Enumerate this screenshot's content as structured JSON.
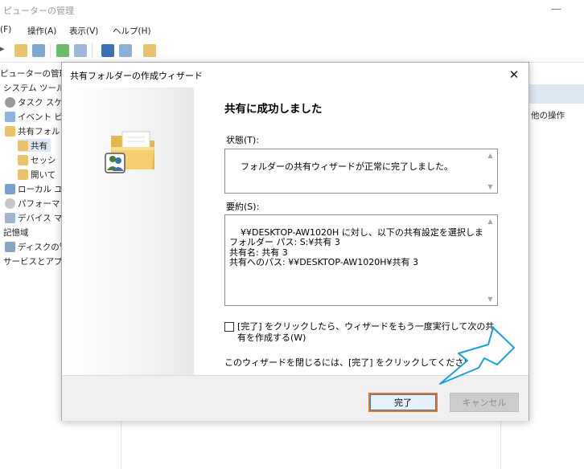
{
  "background": {
    "window_title": "ピューターの管理",
    "menus": [
      "(F)",
      "操作(A)",
      "表示(V)",
      "ヘルプ(H)"
    ],
    "tree": [
      {
        "label": "ピューターの管理",
        "selected": false
      },
      {
        "label": "システム ツール",
        "selected": false
      },
      {
        "label": "タスク スケ",
        "selected": false
      },
      {
        "label": "イベント ビ",
        "selected": false
      },
      {
        "label": "共有フォル",
        "selected": false
      },
      {
        "label": "共有",
        "selected": true
      },
      {
        "label": "セッシ",
        "selected": false
      },
      {
        "label": "開いて",
        "selected": false
      },
      {
        "label": "ローカル ユー",
        "selected": false
      },
      {
        "label": "パフォーマン",
        "selected": false
      },
      {
        "label": "デバイス マ",
        "selected": false
      },
      {
        "label": "記憶域",
        "selected": false
      },
      {
        "label": "ディスクの管",
        "selected": false
      },
      {
        "label": "サービスとアプリ",
        "selected": false
      }
    ],
    "actions_item": "他の操作"
  },
  "dialog": {
    "title": "共有フォルダーの作成ウィザード",
    "heading": "共有に成功しました",
    "status_label": "状態(T):",
    "status_text": "フォルダーの共有ウィザードが正常に完了しました。",
    "summary_label": "要約(S):",
    "summary_text": "¥¥DESKTOP-AW1020H に対し、以下の共有設定を選択しました:\nフォルダー パス: S:¥共有 3\n共有名: 共有 3\n共有へのパス: ¥¥DESKTOP-AW1020H¥共有 3",
    "rerun_checkbox_label": "[完了] をクリックしたら、ウィザードをもう一度実行して次の共有を作成する(W)",
    "rerun_checked": false,
    "close_note": "このウィザードを閉じるには、[完了] をクリックしてください。",
    "finish_button": "完了",
    "cancel_button": "キャンセル",
    "cancel_enabled": false
  },
  "colors": {
    "accent_highlight": "#e8722c",
    "arrow_annotation": "#1aa0dc",
    "tree_selection": "#dfe8f6"
  }
}
